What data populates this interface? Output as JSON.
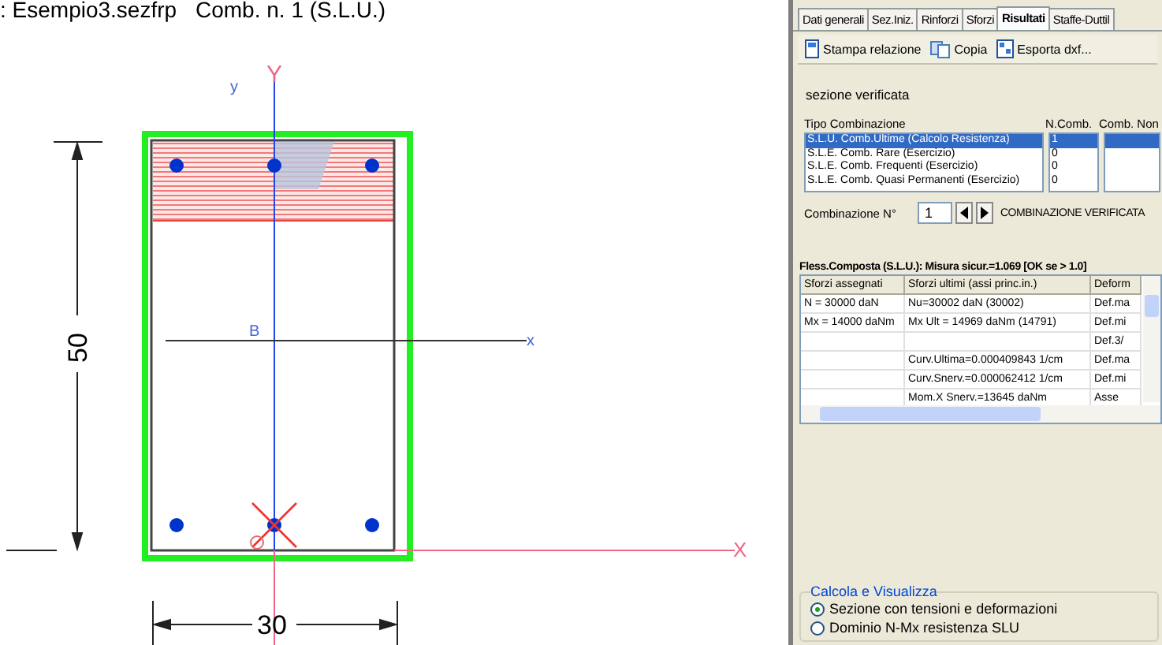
{
  "document": {
    "file": ": Esempio3.sezfrp",
    "combination": "Comb. n. 1 (S.L.U.)"
  },
  "drawing": {
    "height_dim": "50",
    "width_dim": "30",
    "global_y": "Y",
    "global_x": "X",
    "local_y": "y",
    "local_x": "x",
    "centroid": "B"
  },
  "tabs": [
    {
      "label": "Dati generali",
      "selected": false
    },
    {
      "label": "Sez.Iniz.",
      "selected": false
    },
    {
      "label": "Rinforzi",
      "selected": false
    },
    {
      "label": "Sforzi",
      "selected": false
    },
    {
      "label": "Risultati",
      "selected": true
    },
    {
      "label": "Staffe-Duttil",
      "selected": false
    }
  ],
  "toolbar": [
    {
      "label": "Stampa relazione",
      "kind": "print"
    },
    {
      "label": "Copia",
      "kind": "copy"
    },
    {
      "label": "Esporta dxf...",
      "kind": "export"
    }
  ],
  "status_text": "sezione verificata",
  "combinations": {
    "headers": [
      "Tipo  Combinazione",
      "N.Comb.",
      "Comb. Non"
    ],
    "rows": [
      {
        "tipo": "S.L.U. Comb.Ultime (Calcolo Resistenza)",
        "n_comb": "1",
        "selected": true
      },
      {
        "tipo": "S.L.E. Comb. Rare (Esercizio)",
        "n_comb": "0",
        "selected": false
      },
      {
        "tipo": "S.L.E. Comb. Frequenti (Esercizio)",
        "n_comb": "0",
        "selected": false
      },
      {
        "tipo": "S.L.E. Comb. Quasi Permanenti (Esercizio)",
        "n_comb": "0",
        "selected": false
      }
    ]
  },
  "combination_number": {
    "label": "Combinazione N°",
    "value": "1",
    "status": "COMBINAZIONE VERIFICATA"
  },
  "results": {
    "title": "Fless.Composta (S.L.U.): Misura sicur.=1.069 [OK se > 1.0]",
    "columns": [
      "Sforzi assegnati",
      "Sforzi ultimi (assi princ.in.)",
      "Deform"
    ],
    "rows": [
      [
        "N  = 30000 daN",
        "Nu=30002 daN (30002)",
        "Def.ma"
      ],
      [
        "Mx  = 14000 daNm",
        "Mx Ult = 14969 daNm (14791)",
        "Def.mi"
      ],
      [
        "",
        "",
        "Def.3/"
      ],
      [
        "",
        "Curv.Ultima=0.000409843 1/cm",
        "Def.ma"
      ],
      [
        "",
        "Curv.Snerv.=0.000062412 1/cm",
        "Def.mi"
      ],
      [
        "",
        "Mom.X Snerv.=13645 daNm",
        "Asse"
      ]
    ]
  },
  "view_group": {
    "title": "Calcola e Visualizza",
    "options": [
      {
        "label": "Sezione con tensioni e deformazioni",
        "selected": true
      },
      {
        "label": "Dominio N-Mx resistenza SLU",
        "selected": false
      }
    ]
  }
}
